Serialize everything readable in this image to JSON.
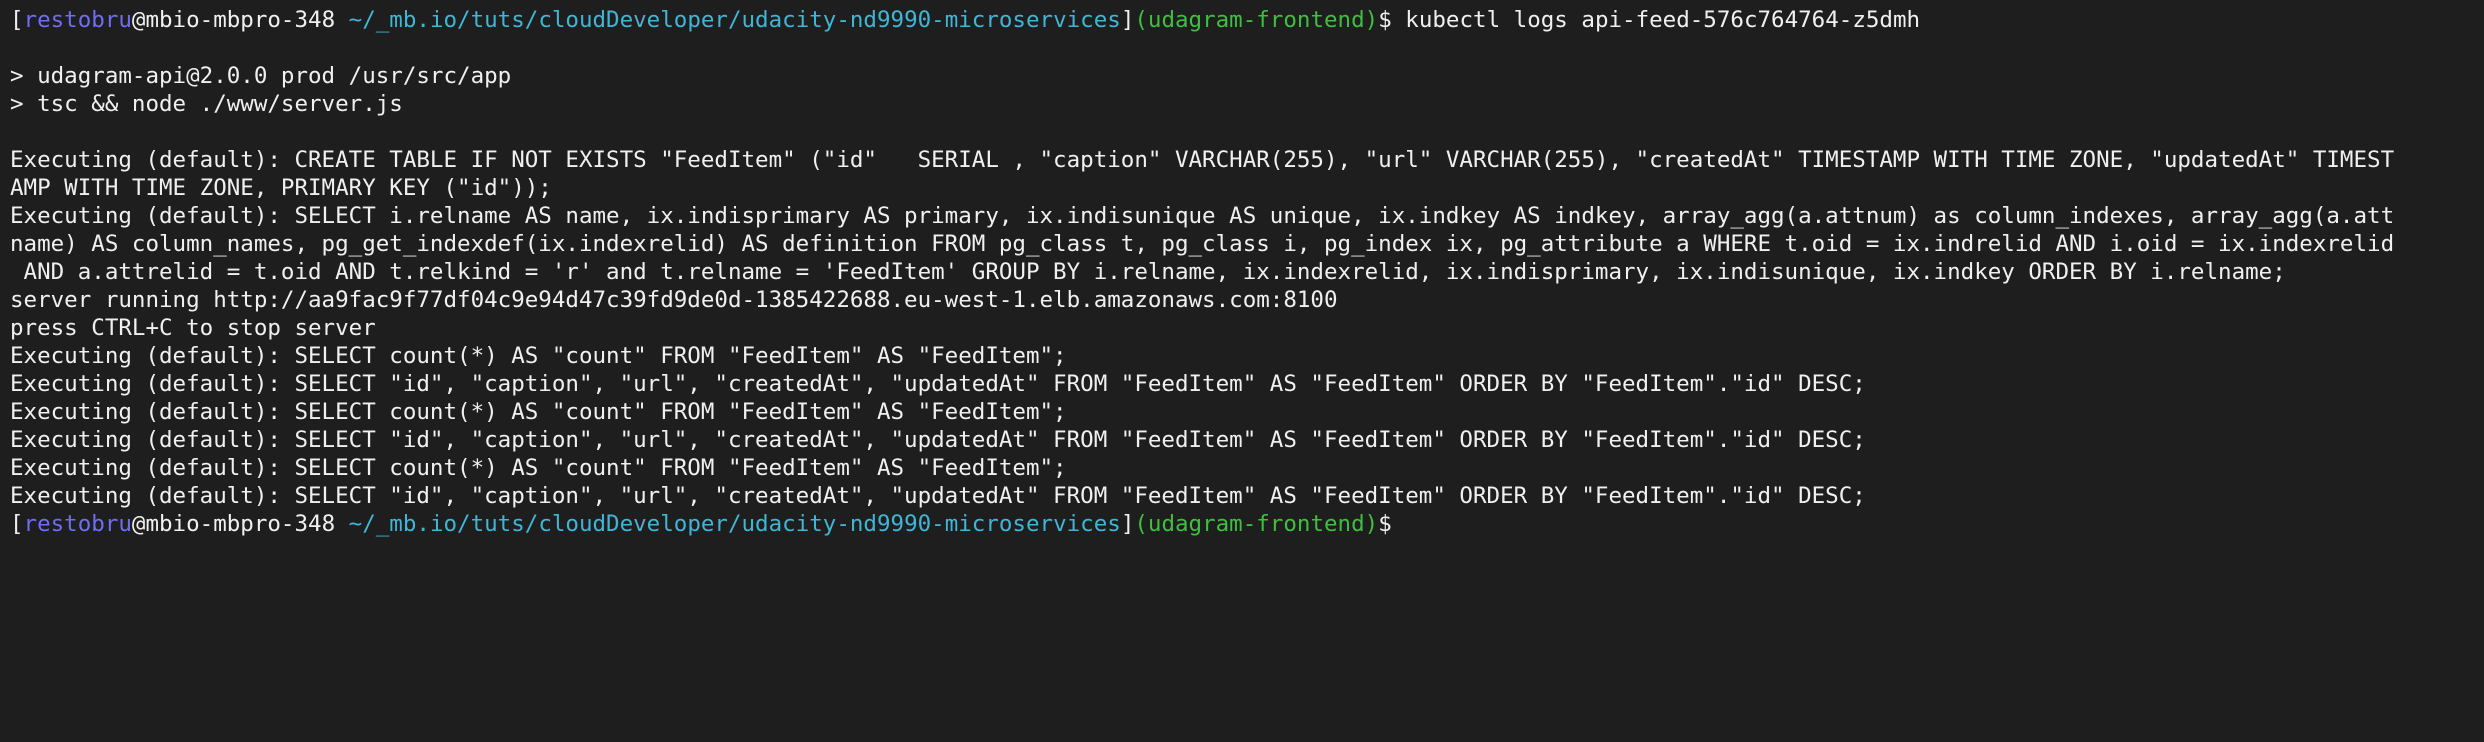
{
  "prompt": {
    "open_bracket": "[",
    "user": "restobru",
    "host": "@mbio-mbpro-348",
    "path": "~/_mb.io/tuts/cloudDeveloper/udacity-nd9990-microservices",
    "close_bracket": "]",
    "branch": "(udagram-frontend)",
    "symbol": "$"
  },
  "command": " kubectl logs api-feed-576c764764-z5dmh",
  "output_lines": [
    "",
    "> udagram-api@2.0.0 prod /usr/src/app",
    "> tsc && node ./www/server.js",
    "",
    "Executing (default): CREATE TABLE IF NOT EXISTS \"FeedItem\" (\"id\"   SERIAL , \"caption\" VARCHAR(255), \"url\" VARCHAR(255), \"createdAt\" TIMESTAMP WITH TIME ZONE, \"updatedAt\" TIMEST",
    "AMP WITH TIME ZONE, PRIMARY KEY (\"id\"));",
    "Executing (default): SELECT i.relname AS name, ix.indisprimary AS primary, ix.indisunique AS unique, ix.indkey AS indkey, array_agg(a.attnum) as column_indexes, array_agg(a.att",
    "name) AS column_names, pg_get_indexdef(ix.indexrelid) AS definition FROM pg_class t, pg_class i, pg_index ix, pg_attribute a WHERE t.oid = ix.indrelid AND i.oid = ix.indexrelid",
    " AND a.attrelid = t.oid AND t.relkind = 'r' and t.relname = 'FeedItem' GROUP BY i.relname, ix.indexrelid, ix.indisprimary, ix.indisunique, ix.indkey ORDER BY i.relname;",
    "server running http://aa9fac9f77df04c9e94d47c39fd9de0d-1385422688.eu-west-1.elb.amazonaws.com:8100",
    "press CTRL+C to stop server",
    "Executing (default): SELECT count(*) AS \"count\" FROM \"FeedItem\" AS \"FeedItem\";",
    "Executing (default): SELECT \"id\", \"caption\", \"url\", \"createdAt\", \"updatedAt\" FROM \"FeedItem\" AS \"FeedItem\" ORDER BY \"FeedItem\".\"id\" DESC;",
    "Executing (default): SELECT count(*) AS \"count\" FROM \"FeedItem\" AS \"FeedItem\";",
    "Executing (default): SELECT \"id\", \"caption\", \"url\", \"createdAt\", \"updatedAt\" FROM \"FeedItem\" AS \"FeedItem\" ORDER BY \"FeedItem\".\"id\" DESC;",
    "Executing (default): SELECT count(*) AS \"count\" FROM \"FeedItem\" AS \"FeedItem\";",
    "Executing (default): SELECT \"id\", \"caption\", \"url\", \"createdAt\", \"updatedAt\" FROM \"FeedItem\" AS \"FeedItem\" ORDER BY \"FeedItem\".\"id\" DESC;"
  ],
  "colors": {
    "background": "#1e1e1e",
    "text": "#f0f0f0",
    "user": "#6f6cf5",
    "path": "#3fb6d6",
    "branch": "#3fbf3f"
  }
}
